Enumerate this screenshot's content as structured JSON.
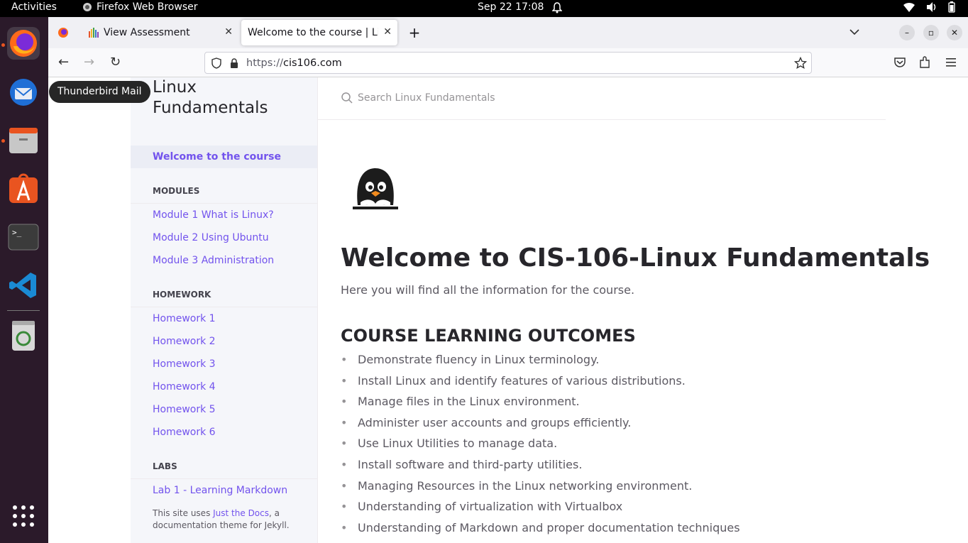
{
  "topbar": {
    "activities": "Activities",
    "app_name": "Firefox Web Browser",
    "clock": "Sep 22  17:08"
  },
  "dock": {
    "items": [
      "firefox-icon",
      "thunderbird-icon",
      "files-icon",
      "app-center-icon",
      "terminal-icon",
      "vscode-icon",
      "trash-icon",
      "show-apps-icon"
    ],
    "tooltip": "Thunderbird Mail"
  },
  "browser": {
    "tabs": [
      {
        "title": "View Assessment"
      },
      {
        "title": "Welcome to the course | Linux Fundamentals"
      }
    ],
    "url_proto": "https://",
    "url_host": "cis106.com"
  },
  "sidebar": {
    "site_title": "Linux Fundamentals",
    "active_item": "Welcome to the course",
    "modules_heading": "MODULES",
    "modules": [
      "Module 1 What is Linux?",
      "Module 2 Using Ubuntu",
      "Module 3 Administration"
    ],
    "homework_heading": "HOMEWORK",
    "homework": [
      "Homework 1",
      "Homework 2",
      "Homework 3",
      "Homework 4",
      "Homework 5",
      "Homework 6"
    ],
    "labs_heading": "LABS",
    "labs": [
      "Lab 1 - Learning Markdown"
    ],
    "footer_prefix": "This site uses ",
    "footer_link": "Just the Docs",
    "footer_suffix": ", a documentation theme for Jekyll."
  },
  "main": {
    "search_placeholder": "Search Linux Fundamentals",
    "title": "Welcome to CIS-106-Linux Fundamentals",
    "lead": "Here you will find all the information for the course.",
    "outcomes_heading": "COURSE LEARNING OUTCOMES",
    "outcomes": [
      "Demonstrate fluency in Linux terminology.",
      "Install Linux and identify features of various distributions.",
      "Manage files in the Linux environment.",
      "Administer user accounts and groups efficiently.",
      "Use Linux Utilities to manage data.",
      "Install software and third-party utilities.",
      "Managing Resources in the Linux networking environment.",
      "Understanding of virtualization with Virtualbox",
      "Understanding of Markdown and proper documentation techniques"
    ]
  }
}
